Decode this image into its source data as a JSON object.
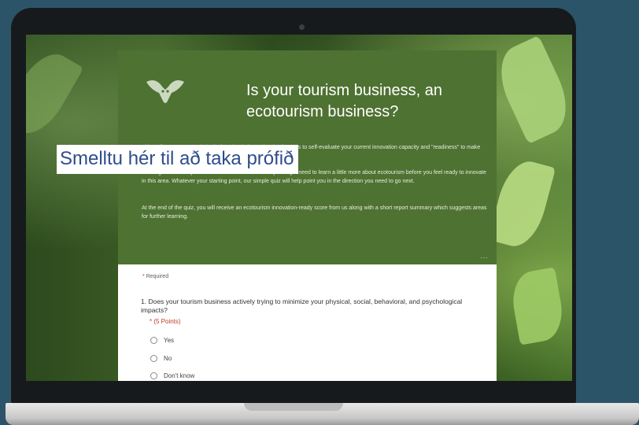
{
  "cta": {
    "label": "Smelltu hér til að taka prófið"
  },
  "form": {
    "logo_icon": "owl-logo-icon",
    "title": "Is your tourism business, an ecotourism business?",
    "intro": [
      "This self assessment quiz is designed to help tourism businesses to self-evaluate your current innovation capacity and \"readiness\" to make the most of ecotourism opportunities.",
      "You might be already active in the area ecotourism or you might need to learn a little more about ecotourism before you feel ready to innovate in this area. Whatever your starting point, our simple quiz will help point you in the direction you need to go next.",
      "At the end of the quiz, you will receive an ecotourism innovation-ready score from us along with a short report summary which suggests areas for further learning."
    ],
    "more": "...",
    "required_mark": "*",
    "required_label": "Required",
    "question": {
      "text": "1. Does your tourism business actively trying to minimize your physical, social, behavioral, and psychological impacts?",
      "points": "* (5 Points)",
      "options": [
        "Yes",
        "No",
        "Don't know"
      ]
    }
  }
}
